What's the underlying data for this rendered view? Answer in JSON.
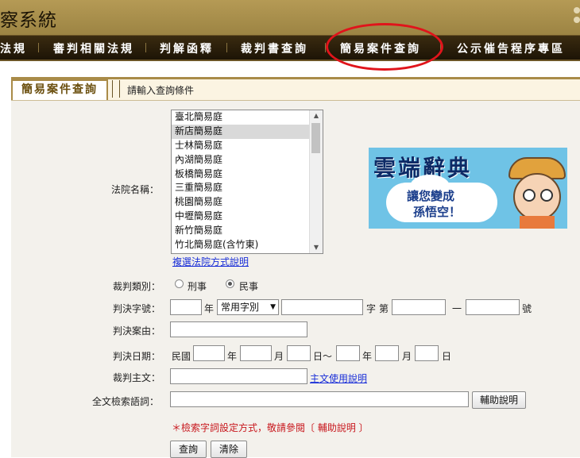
{
  "header": {
    "title": "察系統"
  },
  "nav": {
    "items": [
      "法規",
      "審判相關法規",
      "判解函釋",
      "裁判書查詢",
      "簡易案件查詢",
      "公示催告程序專區"
    ]
  },
  "tab": {
    "label": "簡易案件查詢",
    "hint": "請輸入查詢條件"
  },
  "court": {
    "label": "法院名稱：",
    "options": [
      "臺北簡易庭",
      "新店簡易庭",
      "士林簡易庭",
      "內湖簡易庭",
      "板橋簡易庭",
      "三重簡易庭",
      "桃園簡易庭",
      "中壢簡易庭",
      "新竹簡易庭",
      "竹北簡易庭(含竹東)"
    ],
    "selected": "新店簡易庭",
    "help_link": "複選法院方式說明"
  },
  "category": {
    "label": "裁判類別：",
    "option_criminal": "刑事",
    "option_civil": "民事",
    "selected": "民事"
  },
  "case_no": {
    "label": "判決字號：",
    "year_suffix": "年",
    "word_select": "常用字別",
    "word_label": "字",
    "number_label": "第",
    "dash": "一",
    "number_suffix": "號"
  },
  "cause": {
    "label": "判決案由："
  },
  "date": {
    "label": "判決日期：",
    "era": "民國",
    "year": "年",
    "month": "月",
    "day_to": "日～",
    "day": "日"
  },
  "main_text": {
    "label": "裁判主文：",
    "help_link": "主文使用說明"
  },
  "fulltext": {
    "label": "全文檢索語詞：",
    "help_button": "輔助說明"
  },
  "note": "＊檢索字詞設定方式，敬請參閱〔 輔助說明 〕",
  "buttons": {
    "search": "查詢",
    "clear": "清除"
  },
  "ad": {
    "title": "雲端辭典",
    "line1": "讓您變成",
    "line2": "孫悟空！"
  },
  "colors": {
    "header_gold": "#b59a55",
    "nav_dark": "#2a1e0a",
    "highlight_red": "#e0141b",
    "link_blue": "#1a2fd8",
    "note_red": "#c8171d"
  }
}
